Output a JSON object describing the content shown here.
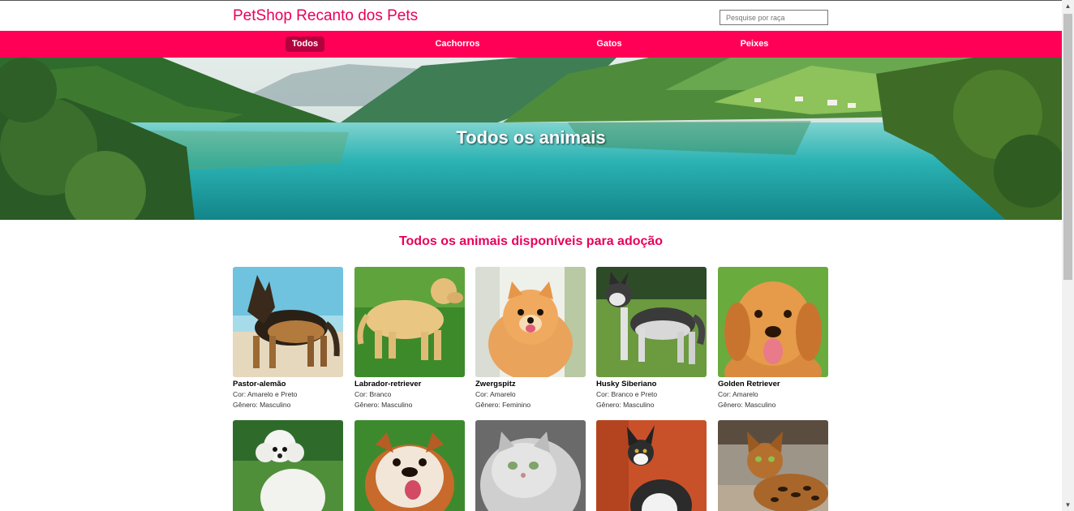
{
  "header": {
    "brand": "PetShop Recanto dos Pets",
    "search_placeholder": "Pesquise por raça"
  },
  "nav": {
    "items": [
      {
        "label": "Todos",
        "active": true
      },
      {
        "label": "Cachorros",
        "active": false
      },
      {
        "label": "Gatos",
        "active": false
      },
      {
        "label": "Peixes",
        "active": false
      }
    ]
  },
  "hero": {
    "title": "Todos os animais"
  },
  "main": {
    "section_title": "Todos os animais disponíveis para adoção",
    "labels": {
      "color": "Cor:",
      "gender": "Gênero:"
    },
    "animals": [
      {
        "name": "Pastor-alemão",
        "color": "Amarelo e Preto",
        "gender": "Masculino",
        "photo_icon": "german-shepherd-photo"
      },
      {
        "name": "Labrador-retriever",
        "color": "Branco",
        "gender": "Masculino",
        "photo_icon": "labrador-photo"
      },
      {
        "name": "Zwergspitz",
        "color": "Amarelo",
        "gender": "Feminino",
        "photo_icon": "pomeranian-photo"
      },
      {
        "name": "Husky Siberiano",
        "color": "Branco e Preto",
        "gender": "Masculino",
        "photo_icon": "husky-photo"
      },
      {
        "name": "Golden Retriever",
        "color": "Amarelo",
        "gender": "Masculino",
        "photo_icon": "golden-retriever-photo"
      },
      {
        "photo_icon": "poodle-photo"
      },
      {
        "photo_icon": "bulldog-photo"
      },
      {
        "photo_icon": "persian-cat-photo"
      },
      {
        "photo_icon": "maine-coon-photo"
      },
      {
        "photo_icon": "bengal-cat-photo"
      }
    ]
  },
  "colors": {
    "brand": "#e8005a",
    "nav_bg": "#ff0056",
    "nav_active": "#b3003f"
  }
}
